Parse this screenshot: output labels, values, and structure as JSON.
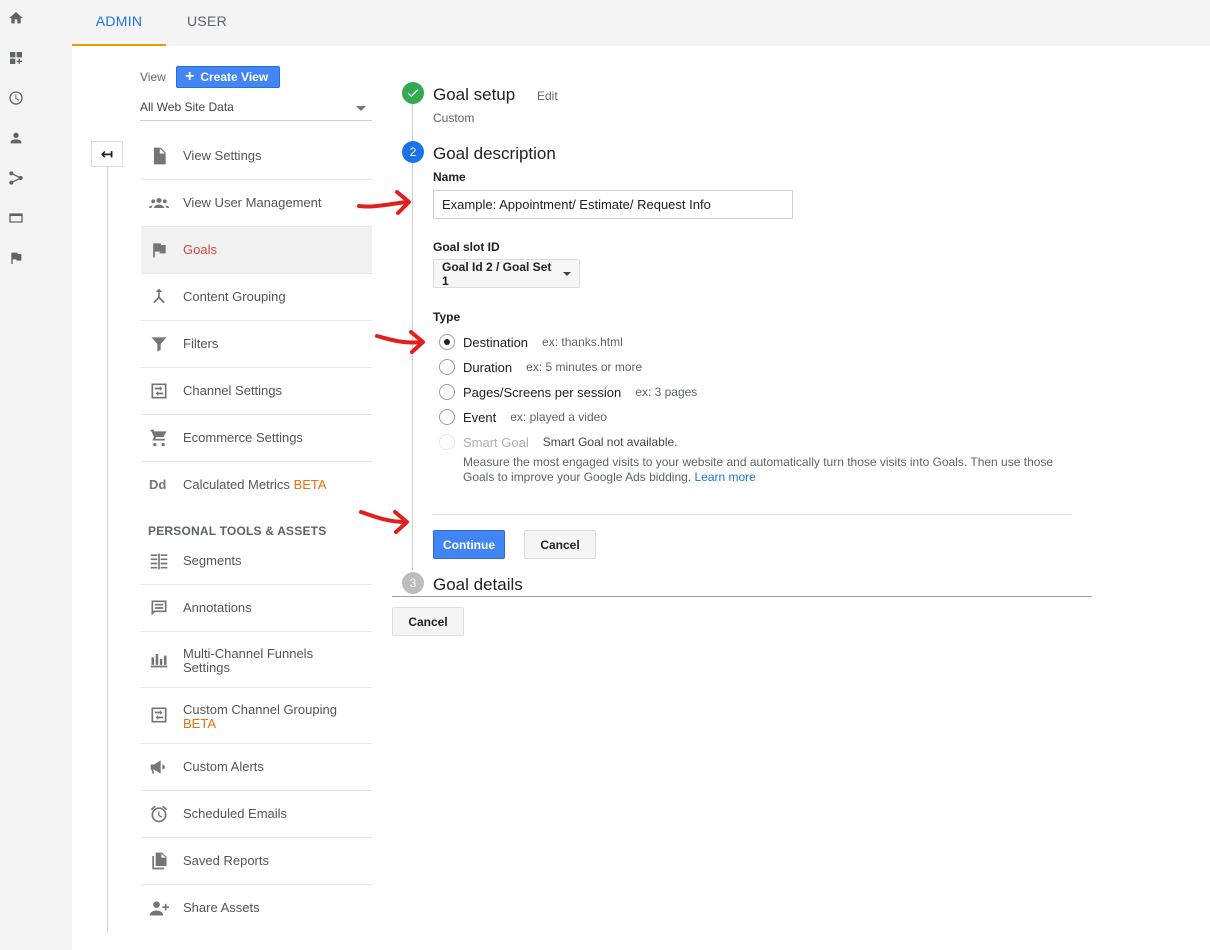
{
  "tabs": [
    {
      "label": "ADMIN",
      "active": true
    },
    {
      "label": "USER",
      "active": false
    }
  ],
  "rail_icons": [
    "home-icon",
    "dashboards-icon",
    "clock-icon",
    "person-icon",
    "acquisition-icon",
    "behavior-icon",
    "conversions-flag-icon"
  ],
  "view": {
    "label": "View",
    "create_button": "Create View",
    "selected": "All Web Site Data"
  },
  "menu": {
    "items": [
      {
        "label": "View Settings",
        "icon": "file-icon"
      },
      {
        "label": "View User Management",
        "icon": "people-icon"
      },
      {
        "label": "Goals",
        "icon": "flag-icon",
        "active": true
      },
      {
        "label": "Content Grouping",
        "icon": "merge-icon"
      },
      {
        "label": "Filters",
        "icon": "filter-icon"
      },
      {
        "label": "Channel Settings",
        "icon": "channel-icon"
      },
      {
        "label": "Ecommerce Settings",
        "icon": "cart-icon"
      },
      {
        "label": "Calculated Metrics",
        "beta": "BETA",
        "icon": "dd-icon"
      }
    ],
    "section_header": "PERSONAL TOOLS & ASSETS",
    "personal_items": [
      {
        "label": "Segments",
        "icon": "segments-icon"
      },
      {
        "label": "Annotations",
        "icon": "annotation-icon"
      },
      {
        "label": "Multi-Channel Funnels",
        "label2": "Settings",
        "icon": "bar-chart-icon"
      },
      {
        "label": "Custom Channel Grouping",
        "beta": "BETA",
        "icon": "channel-icon"
      },
      {
        "label": "Custom Alerts",
        "icon": "megaphone-icon"
      },
      {
        "label": "Scheduled Emails",
        "icon": "alarm-icon"
      },
      {
        "label": "Saved Reports",
        "icon": "report-icon"
      },
      {
        "label": "Share Assets",
        "icon": "person-add-icon"
      }
    ]
  },
  "goal": {
    "step1": {
      "title": "Goal setup",
      "edit": "Edit",
      "sub": "Custom"
    },
    "step2": {
      "number": "2",
      "title": "Goal description",
      "name_label": "Name",
      "name_value": "Example: Appointment/ Estimate/ Request Info",
      "slot_label": "Goal slot ID",
      "slot_value": "Goal Id 2 / Goal Set 1",
      "type_label": "Type",
      "types": [
        {
          "label": "Destination",
          "example": "ex: thanks.html",
          "checked": true
        },
        {
          "label": "Duration",
          "example": "ex: 5 minutes or more"
        },
        {
          "label": "Pages/Screens per session",
          "example": "ex: 3 pages"
        },
        {
          "label": "Event",
          "example": "ex: played a video"
        },
        {
          "label": "Smart Goal",
          "example": "Smart Goal not available.",
          "disabled": true
        }
      ],
      "smart_desc_line1": "Measure the most engaged visits to your website and automatically turn those visits into Goals. Then use those",
      "smart_desc_line2": "Goals to improve your Google Ads bidding.",
      "learn_more": "Learn more",
      "continue": "Continue",
      "cancel": "Cancel"
    },
    "step3": {
      "number": "3",
      "title": "Goal details"
    },
    "cancel": "Cancel"
  },
  "colors": {
    "accent_blue": "#4285f4",
    "tab_active": "#1a73e8",
    "tab_underline": "#f29900",
    "check_green": "#34a853",
    "step_active": "#1a73e8",
    "step_inactive": "#bdbdbd",
    "annotation_red": "#e0201c"
  }
}
